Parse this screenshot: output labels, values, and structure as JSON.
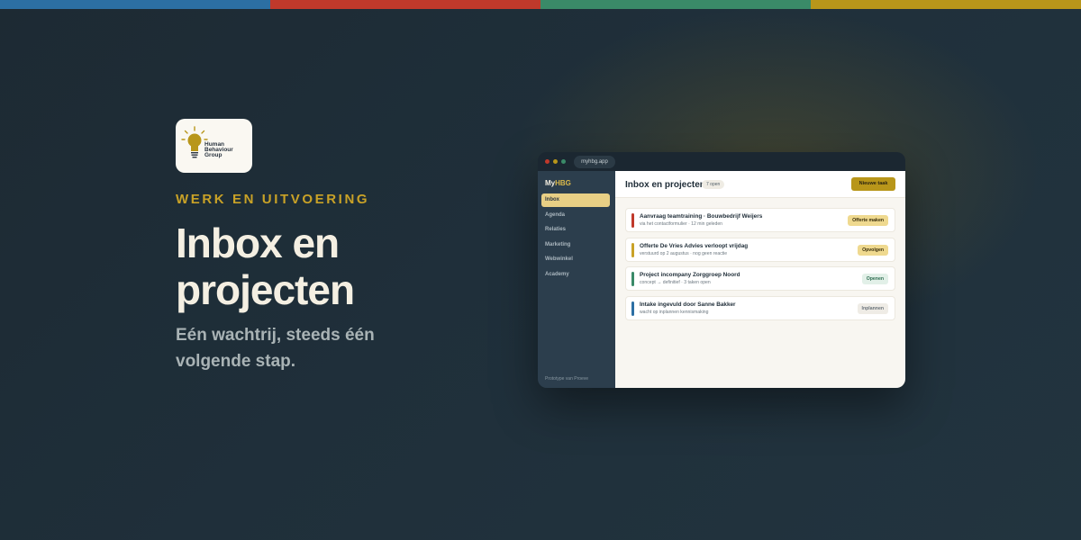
{
  "colors": {
    "stripe_blue": "#2c6fa3",
    "stripe_red": "#c0392b",
    "stripe_green": "#3a8a68",
    "stripe_gold": "#b8961a",
    "accent": "#c9a227"
  },
  "logo": {
    "icon": "lightbulb-icon",
    "line1": "Human",
    "line2": "Behaviour",
    "line3": "Group"
  },
  "hero": {
    "eyebrow": "WERK EN UITVOERING",
    "title": "Inbox en projecten",
    "subtitle": "Eén wachtrij, steeds één volgende stap."
  },
  "app": {
    "url": "myhbg.app",
    "brand_prefix": "My",
    "brand_suffix": "HBG",
    "nav": [
      {
        "label": "Inbox",
        "active": true
      },
      {
        "label": "Agenda",
        "active": false
      },
      {
        "label": "Relaties",
        "active": false
      },
      {
        "label": "Marketing",
        "active": false
      },
      {
        "label": "Webwinkel",
        "active": false
      },
      {
        "label": "Academy",
        "active": false
      }
    ],
    "footer": "Prototype van Proeve",
    "main_title": "Inbox en projecten",
    "open_count": "7 open",
    "new_button": "Nieuwe taak",
    "items": [
      {
        "title": "Aanvraag teamtraining · Bouwbedrijf Weijers",
        "subtitle": "via het contactformulier · 12 min geleden",
        "action": "Offerte maken",
        "color": "#c0392b",
        "action_bg": "#efd98f",
        "action_fg": "#3a2f0c"
      },
      {
        "title": "Offerte De Vries Advies verloopt vrijdag",
        "subtitle": "verstuurd op 2 augustus · nog geen reactie",
        "action": "Opvolgen",
        "color": "#c9a227",
        "action_bg": "#efd98f",
        "action_fg": "#3a2f0c"
      },
      {
        "title": "Project incompany Zorggroep Noord",
        "subtitle": "concept → definitief · 3 taken open",
        "action": "Openen",
        "color": "#3a8a68",
        "action_bg": "#e2f0e8",
        "action_fg": "#2f6e52"
      },
      {
        "title": "Intake ingevuld door Sanne Bakker",
        "subtitle": "wacht op inplannen kennismaking",
        "action": "Inplannen",
        "color": "#2c6fa3",
        "action_bg": "#efece6",
        "action_fg": "#6a737a"
      }
    ]
  }
}
